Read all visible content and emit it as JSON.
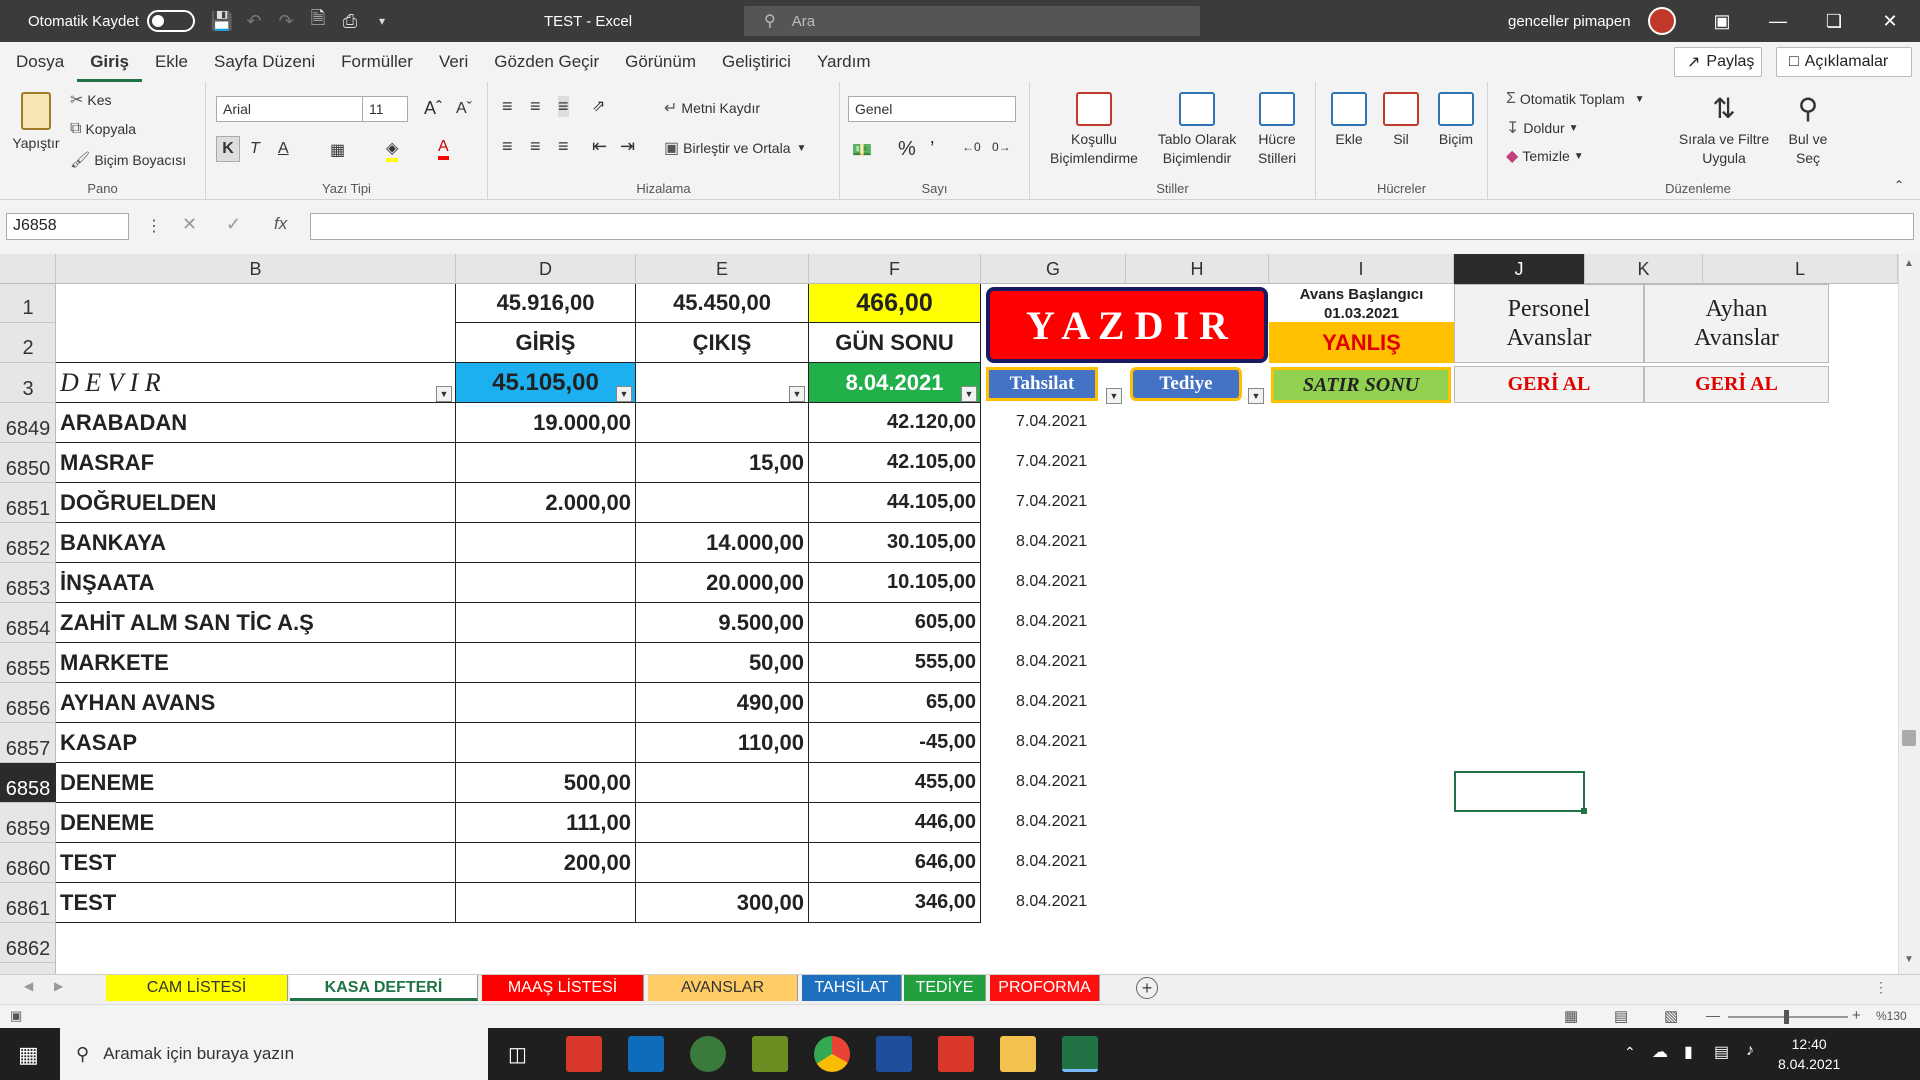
{
  "titlebar": {
    "autosave_label": "Otomatik Kaydet",
    "title": "TEST  -  Excel",
    "search_placeholder": "Ara",
    "user": "genceller pimapen"
  },
  "menu": [
    "Dosya",
    "Giriş",
    "Ekle",
    "Sayfa Düzeni",
    "Formüller",
    "Veri",
    "Gözden Geçir",
    "Görünüm",
    "Geliştirici",
    "Yardım"
  ],
  "menu_active": "Giriş",
  "share_label": "Paylaş",
  "comments_label": "Açıklamalar",
  "ribbon": {
    "pano": {
      "label": "Pano",
      "paste": "Yapıştır",
      "cut": "Kes",
      "copy": "Kopyala",
      "painter": "Biçim Boyacısı"
    },
    "font": {
      "label": "Yazı Tipi",
      "family": "Arial",
      "size": "11",
      "bold": "K",
      "italic": "T",
      "underline": "A"
    },
    "align": {
      "label": "Hizalama",
      "wrap": "Metni Kaydır",
      "merge": "Birleştir ve Ortala"
    },
    "number": {
      "label": "Sayı",
      "format": "Genel"
    },
    "styles": {
      "label": "Stiller",
      "cond1": "Koşullu",
      "cond2": "Biçimlendirme",
      "table1": "Tablo Olarak",
      "table2": "Biçimlendir",
      "cell1": "Hücre",
      "cell2": "Stilleri"
    },
    "cells": {
      "label": "Hücreler",
      "insert": "Ekle",
      "delete": "Sil",
      "format": "Biçim"
    },
    "edit": {
      "label": "Düzenleme",
      "autosum": "Otomatik Toplam",
      "fill": "Doldur",
      "clear": "Temizle",
      "sort1": "Sırala ve Filtre",
      "sort2": "Uygula",
      "find1": "Bul ve",
      "find2": "Seç"
    }
  },
  "namebox": "J6858",
  "columns": [
    "B",
    "D",
    "E",
    "F",
    "G",
    "H",
    "I",
    "J",
    "K",
    "L"
  ],
  "header": {
    "d1": "45.916,00",
    "e1": "45.450,00",
    "f1": "466,00",
    "d2": "GİRİŞ",
    "e2": "ÇIKIŞ",
    "f2": "GÜN SONU",
    "yazdir": "Y A Z D I R",
    "avans_title": "Avans Başlangıcı",
    "avans_date": "01.03.2021",
    "avans_status": "YANLIŞ",
    "personel": "Personel Avanslar",
    "ayhan": "Ayhan Avanslar",
    "devir": "D E V I R",
    "d3": "45.105,00",
    "f3": "8.04.2021",
    "tahsilat": "Tahsilat",
    "tediye": "Tediye",
    "satir_sonu": "SATIR SONU",
    "geri_al": "GERİ AL"
  },
  "rows": [
    {
      "n": "6849",
      "b": "ARABADAN",
      "d": "19.000,00",
      "e": "",
      "f": "42.120,00",
      "g": "7.04.2021"
    },
    {
      "n": "6850",
      "b": "MASRAF",
      "d": "",
      "e": "15,00",
      "f": "42.105,00",
      "g": "7.04.2021"
    },
    {
      "n": "6851",
      "b": "DOĞRUELDEN",
      "d": "2.000,00",
      "e": "",
      "f": "44.105,00",
      "g": "7.04.2021"
    },
    {
      "n": "6852",
      "b": "BANKAYA",
      "d": "",
      "e": "14.000,00",
      "f": "30.105,00",
      "g": "8.04.2021"
    },
    {
      "n": "6853",
      "b": "İNŞAATA",
      "d": "",
      "e": "20.000,00",
      "f": "10.105,00",
      "g": "8.04.2021"
    },
    {
      "n": "6854",
      "b": "ZAHİT ALM SAN TİC A.Ş",
      "d": "",
      "e": "9.500,00",
      "f": "605,00",
      "g": "8.04.2021"
    },
    {
      "n": "6855",
      "b": "MARKETE",
      "d": "",
      "e": "50,00",
      "f": "555,00",
      "g": "8.04.2021"
    },
    {
      "n": "6856",
      "b": "AYHAN AVANS",
      "d": "",
      "e": "490,00",
      "f": "65,00",
      "g": "8.04.2021"
    },
    {
      "n": "6857",
      "b": "KASAP",
      "d": "",
      "e": "110,00",
      "f": "-45,00",
      "g": "8.04.2021"
    },
    {
      "n": "6858",
      "b": "DENEME",
      "d": "500,00",
      "e": "",
      "f": "455,00",
      "g": "8.04.2021"
    },
    {
      "n": "6859",
      "b": "DENEME",
      "d": "111,00",
      "e": "",
      "f": "446,00",
      "g": "8.04.2021"
    },
    {
      "n": "6860",
      "b": "TEST",
      "d": "200,00",
      "e": "",
      "f": "646,00",
      "g": "8.04.2021"
    },
    {
      "n": "6861",
      "b": "TEST",
      "d": "",
      "e": "300,00",
      "f": "346,00",
      "g": "8.04.2021"
    },
    {
      "n": "6862",
      "b": "",
      "d": "",
      "e": "",
      "f": "",
      "g": ""
    }
  ],
  "sheets": [
    {
      "name": "CAM LİSTESİ",
      "bg": "#ffff00",
      "fg": "#333333"
    },
    {
      "name": "KASA DEFTERİ",
      "bg": "#ffffff",
      "fg": "#217346"
    },
    {
      "name": "MAAŞ LİSTESİ",
      "bg": "#ff0000",
      "fg": "#ffffff"
    },
    {
      "name": "AVANSLAR",
      "bg": "#ffcc66",
      "fg": "#333333"
    },
    {
      "name": "TAHSİLAT",
      "bg": "#1f6fbf",
      "fg": "#ffffff"
    },
    {
      "name": "TEDİYE",
      "bg": "#22a040",
      "fg": "#ffffff"
    },
    {
      "name": "PROFORMA",
      "bg": "#ff1010",
      "fg": "#ffffff"
    }
  ],
  "status": {
    "zoom": "%130"
  },
  "taskbar": {
    "search_placeholder": "Aramak için buraya yazın",
    "time": "12:40",
    "date": "8.04.2021"
  },
  "colors": {
    "accent": "#217346",
    "yellow": "#ffff00",
    "cyan": "#1cb0f0",
    "green": "#22b04a",
    "red": "#ff0000",
    "orange": "#ffc000"
  }
}
